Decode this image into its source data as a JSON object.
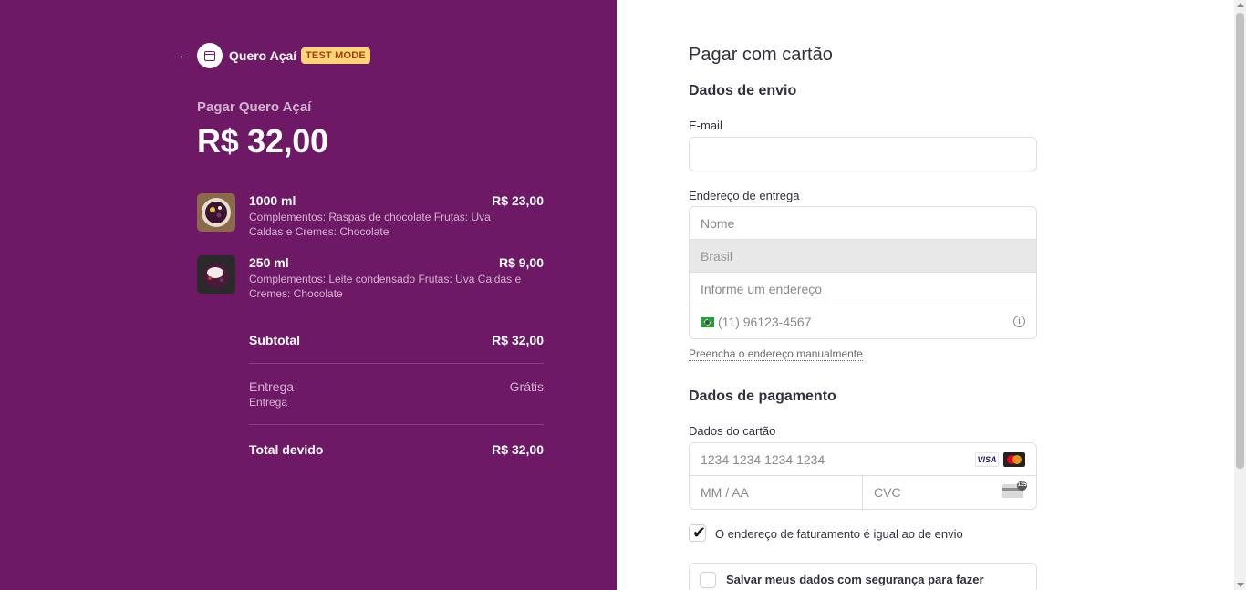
{
  "colors": {
    "brand_panel": "#6e1966",
    "test_badge_bg": "#ffd57a",
    "test_badge_text": "#a0410d"
  },
  "header": {
    "back_icon": "arrow-left-icon",
    "store_icon": "store-icon",
    "store_name": "Quero Açaí",
    "test_mode": "TEST MODE"
  },
  "summary": {
    "pay_label": "Pagar Quero Açaí",
    "amount": "R$ 32,00",
    "items": [
      {
        "name": "1000 ml",
        "price": "R$ 23,00",
        "description": "Complementos: Raspas de chocolate Frutas: Uva Caldas e Cremes: Chocolate"
      },
      {
        "name": "250 ml",
        "price": "R$ 9,00",
        "description": "Complementos: Leite condensado Frutas: Uva Caldas e Cremes: Chocolate"
      }
    ],
    "subtotal_label": "Subtotal",
    "subtotal_value": "R$ 32,00",
    "shipping_label": "Entrega",
    "shipping_sub": "Entrega",
    "shipping_value": "Grátis",
    "total_label": "Total devido",
    "total_value": "R$ 32,00"
  },
  "form": {
    "title": "Pagar com cartão",
    "shipping_section": "Dados de envio",
    "email_label": "E-mail",
    "email_value": "",
    "address_label": "Endereço de entrega",
    "name_placeholder": "Nome",
    "country_value": "Brasil",
    "address_placeholder": "Informe um endereço",
    "phone_placeholder": "(11) 96123-4567",
    "manual_link": "Preencha o endereço manualmente",
    "payment_section": "Dados de pagamento",
    "card_label": "Dados do cartão",
    "card_number_placeholder": "1234 1234 1234 1234",
    "visa_text": "VISA",
    "expiry_placeholder": "MM / AA",
    "cvc_placeholder": "CVC",
    "cvc_badge": "135",
    "billing_same_label": "O endereço de faturamento é igual ao de envio",
    "billing_same_checked": true,
    "save_label": "Salvar meus dados com segurança para fazer"
  }
}
